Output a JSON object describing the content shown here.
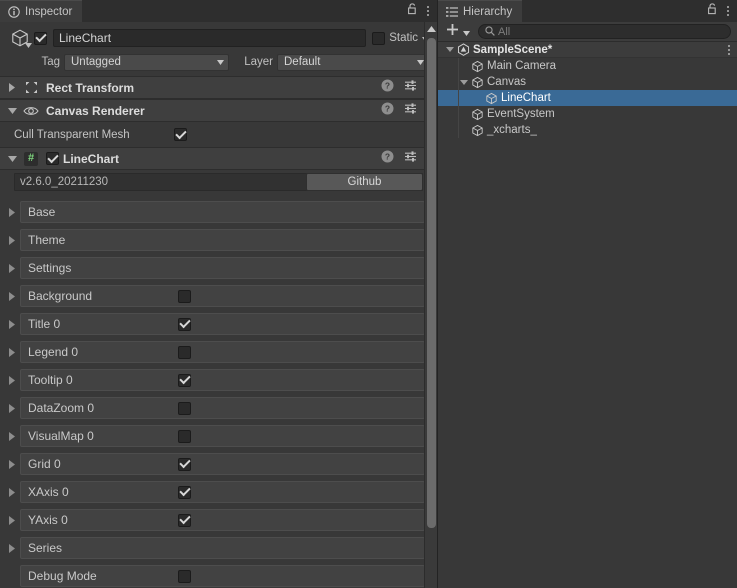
{
  "inspector": {
    "tab_label": "Inspector",
    "tab_icon": "info-circle-icon",
    "lock_icon": "padlock-unlocked-icon",
    "menu_icon": "kebab-menu-icon",
    "object": {
      "icon": "gameobject-cube-icon",
      "enabled": true,
      "name": "LineChart",
      "static_checked": false,
      "static_label": "Static",
      "tag_label": "Tag",
      "tag_value": "Untagged",
      "layer_label": "Layer",
      "layer_value": "Default"
    },
    "components": [
      {
        "name": "Rect Transform",
        "icon": "rect-transform-icon",
        "expanded": false,
        "has_enable_checkbox": false
      },
      {
        "name": "Canvas Renderer",
        "icon": "eye-icon",
        "expanded": true,
        "has_enable_checkbox": false
      },
      {
        "name": "LineChart",
        "icon": "csharp-script-icon",
        "icon_glyph": "#",
        "expanded": true,
        "has_enable_checkbox": true,
        "enabled": true
      }
    ],
    "canvas_renderer_props": [
      {
        "label": "Cull Transparent Mesh",
        "checked": true
      }
    ],
    "linechart": {
      "version": "v2.6.0_20211230",
      "github_button": "Github"
    },
    "foldouts": [
      {
        "label": "Base",
        "arrow": true,
        "has_checkbox": false,
        "checked": false
      },
      {
        "label": "Theme",
        "arrow": true,
        "has_checkbox": false,
        "checked": false
      },
      {
        "label": "Settings",
        "arrow": true,
        "has_checkbox": false,
        "checked": false
      },
      {
        "label": "Background",
        "arrow": true,
        "has_checkbox": true,
        "checked": false
      },
      {
        "label": "Title 0",
        "arrow": true,
        "has_checkbox": true,
        "checked": true
      },
      {
        "label": "Legend 0",
        "arrow": true,
        "has_checkbox": true,
        "checked": false
      },
      {
        "label": "Tooltip 0",
        "arrow": true,
        "has_checkbox": true,
        "checked": true
      },
      {
        "label": "DataZoom 0",
        "arrow": true,
        "has_checkbox": true,
        "checked": false
      },
      {
        "label": "VisualMap 0",
        "arrow": true,
        "has_checkbox": true,
        "checked": false
      },
      {
        "label": "Grid 0",
        "arrow": true,
        "has_checkbox": true,
        "checked": true
      },
      {
        "label": "XAxis 0",
        "arrow": true,
        "has_checkbox": true,
        "checked": true
      },
      {
        "label": "YAxis 0",
        "arrow": true,
        "has_checkbox": true,
        "checked": true
      },
      {
        "label": "Series",
        "arrow": true,
        "has_checkbox": false,
        "checked": false
      },
      {
        "label": "Debug Mode",
        "arrow": false,
        "has_checkbox": true,
        "checked": false
      }
    ],
    "component_tool_icons": [
      "help-icon",
      "preset-icon",
      "kebab-menu-icon"
    ]
  },
  "hierarchy": {
    "tab_label": "Hierarchy",
    "tab_icon": "hierarchy-list-icon",
    "lock_icon": "padlock-unlocked-icon",
    "menu_icon": "kebab-menu-icon",
    "create_label": "+",
    "create_icon": "plus-icon",
    "create_dropdown_icon": "chevron-down-icon",
    "search_icon": "search-icon",
    "search_value": "",
    "search_placeholder": "All",
    "tree": [
      {
        "label": "SampleScene*",
        "icon": "unity-scene-icon",
        "depth": 0,
        "arrow": "down",
        "selected": false,
        "is_scene": true
      },
      {
        "label": "Main Camera",
        "icon": "gameobject-cube-icon",
        "depth": 1,
        "arrow": "none",
        "selected": false,
        "is_scene": false
      },
      {
        "label": "Canvas",
        "icon": "gameobject-cube-icon",
        "depth": 1,
        "arrow": "down",
        "selected": false,
        "is_scene": false
      },
      {
        "label": "LineChart",
        "icon": "gameobject-cube-icon",
        "depth": 2,
        "arrow": "none",
        "selected": true,
        "is_scene": false
      },
      {
        "label": "EventSystem",
        "icon": "gameobject-cube-icon",
        "depth": 1,
        "arrow": "none",
        "selected": false,
        "is_scene": false
      },
      {
        "label": "_xcharts_",
        "icon": "gameobject-cube-icon",
        "depth": 1,
        "arrow": "none",
        "selected": false,
        "is_scene": false
      }
    ]
  },
  "colors": {
    "panel_bg": "#383838",
    "header_bg": "#3f3f3f",
    "tab_bg": "#3c3c3c",
    "tabbar_bg": "#2e2e2e",
    "selection_blue": "#3a6a96",
    "text": "#c8c8c8",
    "foldout_bg": "#424242",
    "script_green": "#7fd67f"
  }
}
